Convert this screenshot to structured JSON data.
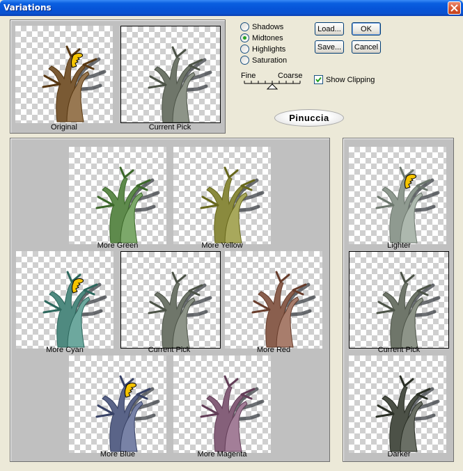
{
  "window": {
    "title": "Variations"
  },
  "top_preview": {
    "original_caption": "Original",
    "current_caption": "Current Pick"
  },
  "range": {
    "options": [
      {
        "label": "Shadows",
        "selected": false
      },
      {
        "label": "Midtones",
        "selected": true
      },
      {
        "label": "Highlights",
        "selected": false
      },
      {
        "label": "Saturation",
        "selected": false
      }
    ]
  },
  "buttons": {
    "load": "Load...",
    "ok": "OK",
    "save": "Save...",
    "cancel": "Cancel"
  },
  "slider": {
    "fine_label": "Fine",
    "coarse_label": "Coarse",
    "position": 0.5
  },
  "show_clipping": {
    "label": "Show Clipping",
    "checked": true
  },
  "watermark": {
    "text": "Pinuccia"
  },
  "hue_grid": [
    {
      "caption": "More Green",
      "tint": "#5e8a4c",
      "selected": false
    },
    {
      "caption": "More Yellow",
      "tint": "#8a8a3e",
      "selected": false
    },
    {
      "caption": "More Cyan",
      "tint": "#4f8a80",
      "selected": false
    },
    {
      "caption": "Current Pick",
      "tint": "#6f766a",
      "selected": true
    },
    {
      "caption": "More Red",
      "tint": "#8a5f4e",
      "selected": false
    },
    {
      "caption": "More Blue",
      "tint": "#5a6488",
      "selected": false
    },
    {
      "caption": "More Magenta",
      "tint": "#85607a",
      "selected": false
    }
  ],
  "brightness": [
    {
      "caption": "Lighter",
      "tint": "#8f9a90"
    },
    {
      "caption": "Current Pick",
      "tint": "#6f766a"
    },
    {
      "caption": "Darker",
      "tint": "#4c5147"
    }
  ],
  "original_tint": "#7a5a34",
  "hand_cursor": "pointing-hand-icon"
}
